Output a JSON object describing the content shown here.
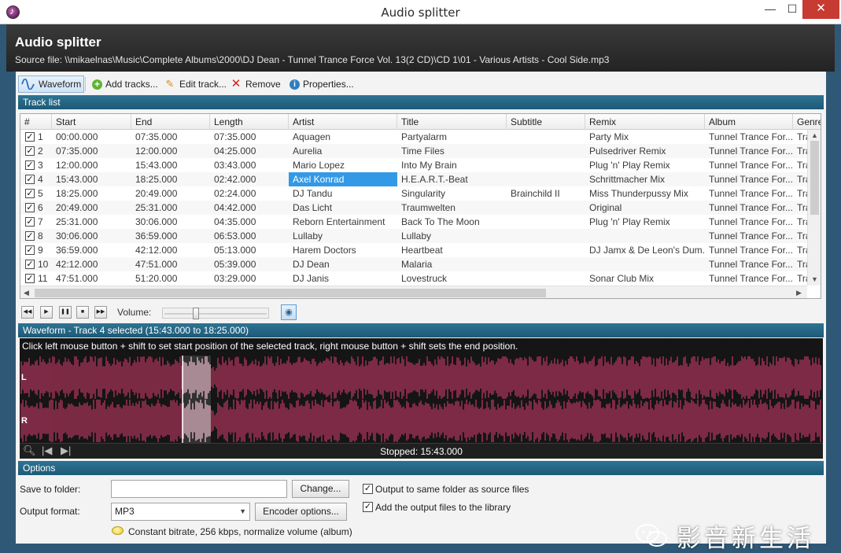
{
  "window": {
    "title": "Audio splitter",
    "minimize": "—",
    "maximize": "☐",
    "close": "✕"
  },
  "header": {
    "title": "Audio splitter",
    "source_file": "Source file: \\\\mikaelnas\\Music\\Complete Albums\\2000\\DJ Dean - Tunnel Trance Force Vol. 13(2 CD)\\CD 1\\01 - Various Artists - Cool Side.mp3"
  },
  "toolbar": {
    "waveform": "Waveform",
    "add_tracks": "Add tracks...",
    "edit_track": "Edit track...",
    "remove": "Remove",
    "properties": "Properties..."
  },
  "track_list": {
    "header": "Track list",
    "columns": [
      "#",
      "Start",
      "End",
      "Length",
      "Artist",
      "Title",
      "Subtitle",
      "Remix",
      "Album",
      "Genre"
    ],
    "rows": [
      {
        "num": "1",
        "start": "00:00.000",
        "end": "07:35.000",
        "length": "07:35.000",
        "artist": "Aquagen",
        "title": "Partyalarm",
        "subtitle": "",
        "remix": "Party Mix",
        "album": "Tunnel Trance For...",
        "genre": "Tra"
      },
      {
        "num": "2",
        "start": "07:35.000",
        "end": "12:00.000",
        "length": "04:25.000",
        "artist": "Aurelia",
        "title": "Time Files",
        "subtitle": "",
        "remix": "Pulsedriver Remix",
        "album": "Tunnel Trance For...",
        "genre": "Tra"
      },
      {
        "num": "3",
        "start": "12:00.000",
        "end": "15:43.000",
        "length": "03:43.000",
        "artist": "Mario Lopez",
        "title": "Into My Brain",
        "subtitle": "",
        "remix": "Plug 'n' Play Remix",
        "album": "Tunnel Trance For...",
        "genre": "Tra"
      },
      {
        "num": "4",
        "start": "15:43.000",
        "end": "18:25.000",
        "length": "02:42.000",
        "artist": "Axel Konrad",
        "title": "H.E.A.R.T.-Beat",
        "subtitle": "",
        "remix": "Schrittmacher Mix",
        "album": "Tunnel Trance For...",
        "genre": "Tra"
      },
      {
        "num": "5",
        "start": "18:25.000",
        "end": "20:49.000",
        "length": "02:24.000",
        "artist": "DJ Tandu",
        "title": "Singularity",
        "subtitle": "Brainchild II",
        "remix": "Miss Thunderpussy Mix",
        "album": "Tunnel Trance For...",
        "genre": "Tra"
      },
      {
        "num": "6",
        "start": "20:49.000",
        "end": "25:31.000",
        "length": "04:42.000",
        "artist": "Das Licht",
        "title": "Traumwelten",
        "subtitle": "",
        "remix": "Original",
        "album": "Tunnel Trance For...",
        "genre": "Tra"
      },
      {
        "num": "7",
        "start": "25:31.000",
        "end": "30:06.000",
        "length": "04:35.000",
        "artist": "Reborn Entertainment",
        "title": "Back To The Moon",
        "subtitle": "",
        "remix": "Plug 'n' Play Remix",
        "album": "Tunnel Trance For...",
        "genre": "Tra"
      },
      {
        "num": "8",
        "start": "30:06.000",
        "end": "36:59.000",
        "length": "06:53.000",
        "artist": "Lullaby",
        "title": "Lullaby",
        "subtitle": "",
        "remix": "",
        "album": "Tunnel Trance For...",
        "genre": "Tra"
      },
      {
        "num": "9",
        "start": "36:59.000",
        "end": "42:12.000",
        "length": "05:13.000",
        "artist": "Harem Doctors",
        "title": "Heartbeat",
        "subtitle": "",
        "remix": "DJ Jamx & De Leon's Dum...",
        "album": "Tunnel Trance For...",
        "genre": "Tra"
      },
      {
        "num": "10",
        "start": "42:12.000",
        "end": "47:51.000",
        "length": "05:39.000",
        "artist": "DJ Dean",
        "title": "Malaria",
        "subtitle": "",
        "remix": "",
        "album": "Tunnel Trance For...",
        "genre": "Tra"
      },
      {
        "num": "11",
        "start": "47:51.000",
        "end": "51:20.000",
        "length": "03:29.000",
        "artist": "DJ Janis",
        "title": "Lovestruck",
        "subtitle": "",
        "remix": "Sonar Club Mix",
        "album": "Tunnel Trance For...",
        "genre": "Tra"
      }
    ],
    "selected_row": 4,
    "selected_cell": "artist"
  },
  "transport": {
    "volume_label": "Volume:",
    "volume_level": 0.3
  },
  "waveform": {
    "header": "Waveform - Track 4 selected (15:43.000 to 18:25.000)",
    "hint": "Click left mouse button + shift to set start position of the selected track, right mouse button + shift sets the end position.",
    "channel_left": "L",
    "channel_right": "R",
    "status": "Stopped: 15:43.000",
    "colors": {
      "wave": "#a8345a",
      "selected_wave": "#d8a6b8",
      "background": "#151515"
    }
  },
  "options": {
    "header": "Options",
    "save_folder_label": "Save to folder:",
    "save_folder_value": "",
    "change_button": "Change...",
    "output_format_label": "Output format:",
    "output_format_value": "MP3",
    "encoder_options_button": "Encoder options...",
    "same_folder_label": "Output to same folder as source files",
    "same_folder_checked": true,
    "add_library_label": "Add the output files to the library",
    "add_library_checked": true,
    "encoder_summary": "Constant bitrate, 256 kbps, normalize volume (album)"
  },
  "watermark": {
    "text": "影音新生活"
  }
}
